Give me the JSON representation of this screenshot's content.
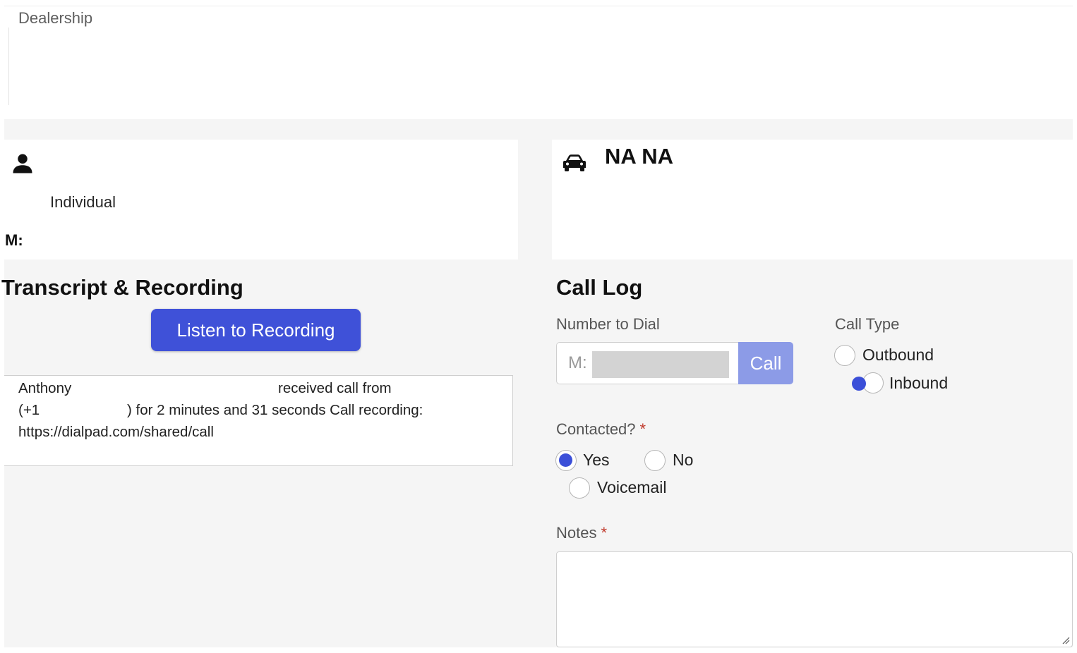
{
  "dealership": {
    "label": "Dealership"
  },
  "contact": {
    "type": "Individual",
    "mobile_label": "M:"
  },
  "vehicle": {
    "name": "NA NA"
  },
  "transcript": {
    "title": "Transcript & Recording",
    "listen_button": "Listen to Recording",
    "line1_left": "Anthony",
    "line1_right": "received call from",
    "line2_left": "(+1",
    "line2_right": ") for 2 minutes and 31 seconds Call recording:",
    "line3": "https://dialpad.com/shared/call"
  },
  "call_log": {
    "title": "Call Log",
    "number_label": "Number to Dial",
    "number_prefix": "M:",
    "call_button": "Call",
    "call_type_label": "Call Type",
    "call_type_options": [
      {
        "label": "Outbound",
        "selected": false
      },
      {
        "label": "Inbound",
        "selected": true
      }
    ],
    "contacted_label": "Contacted?",
    "contacted_options": [
      {
        "label": "Yes",
        "selected": true
      },
      {
        "label": "No",
        "selected": false
      },
      {
        "label": "Voicemail",
        "selected": false
      }
    ],
    "notes_label": "Notes",
    "required_marker": "*",
    "notes_value": ""
  },
  "colors": {
    "primary": "#3f51d8",
    "call_button": "#8c9be7",
    "required": "#c0392b",
    "background": "#f5f5f5"
  },
  "icons": {
    "person": "person-icon",
    "vehicle": "car-icon"
  }
}
